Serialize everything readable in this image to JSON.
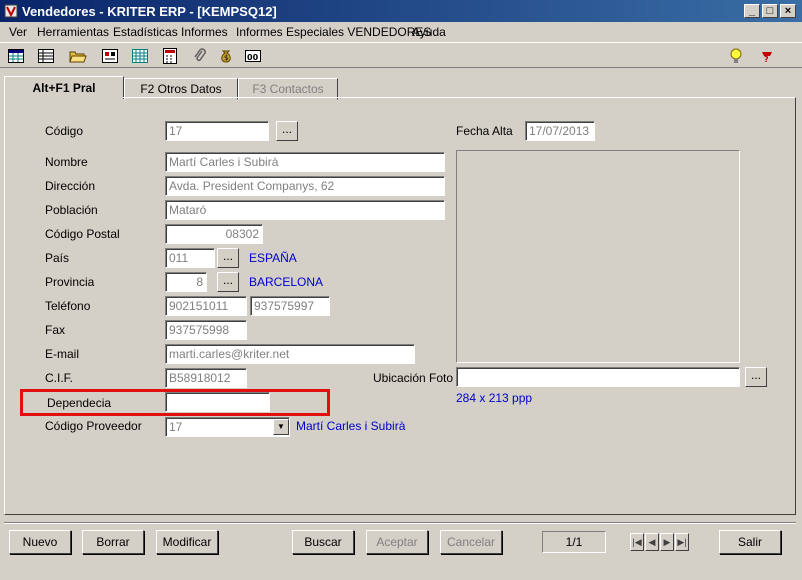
{
  "window": {
    "title": "Vendedores - KRITER ERP - [KEMPSQ12]"
  },
  "menu": [
    "Ver",
    "Herramientas",
    "Estadísticas",
    "Informes",
    "Informes Especiales VENDEDORES",
    "Ayuda"
  ],
  "tabs": [
    "Alt+F1 Pral",
    "F2 Otros Datos",
    "F3 Contactos"
  ],
  "form": {
    "codigo": {
      "label": "Código",
      "value": "17"
    },
    "fecha_alta": {
      "label": "Fecha Alta",
      "value": "17/07/2013"
    },
    "nombre": {
      "label": "Nombre",
      "value": "Martí Carles i Subirà"
    },
    "direccion": {
      "label": "Dirección",
      "value": "Avda. President Companys, 62"
    },
    "poblacion": {
      "label": "Población",
      "value": "Mataró"
    },
    "codigo_postal": {
      "label": "Código Postal",
      "value": "08302"
    },
    "pais": {
      "label": "País",
      "code": "011",
      "name": "ESPAÑA"
    },
    "provincia": {
      "label": "Provincia",
      "code": "8",
      "name": "BARCELONA"
    },
    "telefono": {
      "label": "Teléfono",
      "value1": "902151011",
      "value2": "937575997"
    },
    "fax": {
      "label": "Fax",
      "value": "937575998"
    },
    "email": {
      "label": "E-mail",
      "value": "marti.carles@kriter.net"
    },
    "cif": {
      "label": "C.I.F.",
      "value": "B58918012"
    },
    "ubicacion_foto": {
      "label": "Ubicación Foto",
      "value": "",
      "size_text": "284 x 213 ppp"
    },
    "dependecia": {
      "label": "Dependecia",
      "value": ""
    },
    "codigo_proveedor": {
      "label": "Código Proveedor",
      "value": "17",
      "name": "Martí Carles i Subirà"
    },
    "ellipsis": "..."
  },
  "buttons": {
    "nuevo": "Nuevo",
    "borrar": "Borrar",
    "modificar": "Modificar",
    "buscar": "Buscar",
    "aceptar": "Aceptar",
    "cancelar": "Cancelar",
    "salir": "Salir"
  },
  "record": {
    "position": "1/1"
  },
  "colors": {
    "highlight": "#e01010",
    "link": "#0000cc",
    "title_bar": "#0a246a"
  }
}
